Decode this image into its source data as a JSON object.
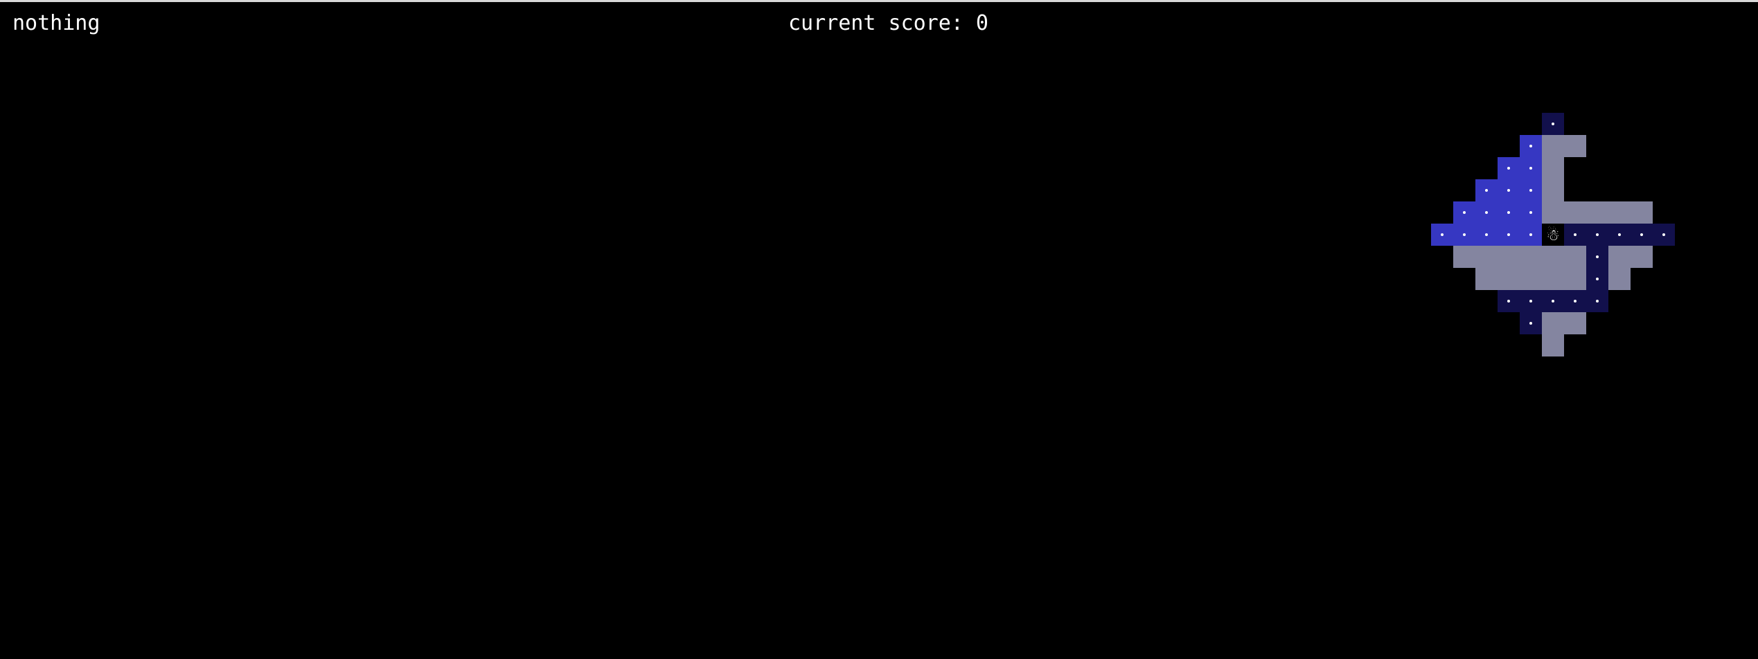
{
  "status": {
    "message": "nothing",
    "score_label": "current score: 0"
  },
  "colors": {
    "background": "#000000",
    "wall": "#8485a0",
    "visited_floor": "#3637c2",
    "unvisited_floor": "#12104c",
    "pellet": "#ffffff",
    "player_cell": "#000000"
  },
  "player": {
    "icon": "snowman-icon",
    "glyph": "☃"
  },
  "map": {
    "legend": {
      "#": "wall",
      "B": "visited_floor",
      "N": "unvisited_floor",
      "P": "player"
    },
    "rows": [
      "     N     ",
      "    B##    ",
      "   BB#     ",
      "  BBB#     ",
      " BBBB#####",
      "BBBBBPNNNNN",
      " ######N## ",
      "  #####N#  ",
      "   NNNNN   ",
      "    N##    ",
      "     #     "
    ],
    "pellets": "every floor cell except the player cell"
  }
}
